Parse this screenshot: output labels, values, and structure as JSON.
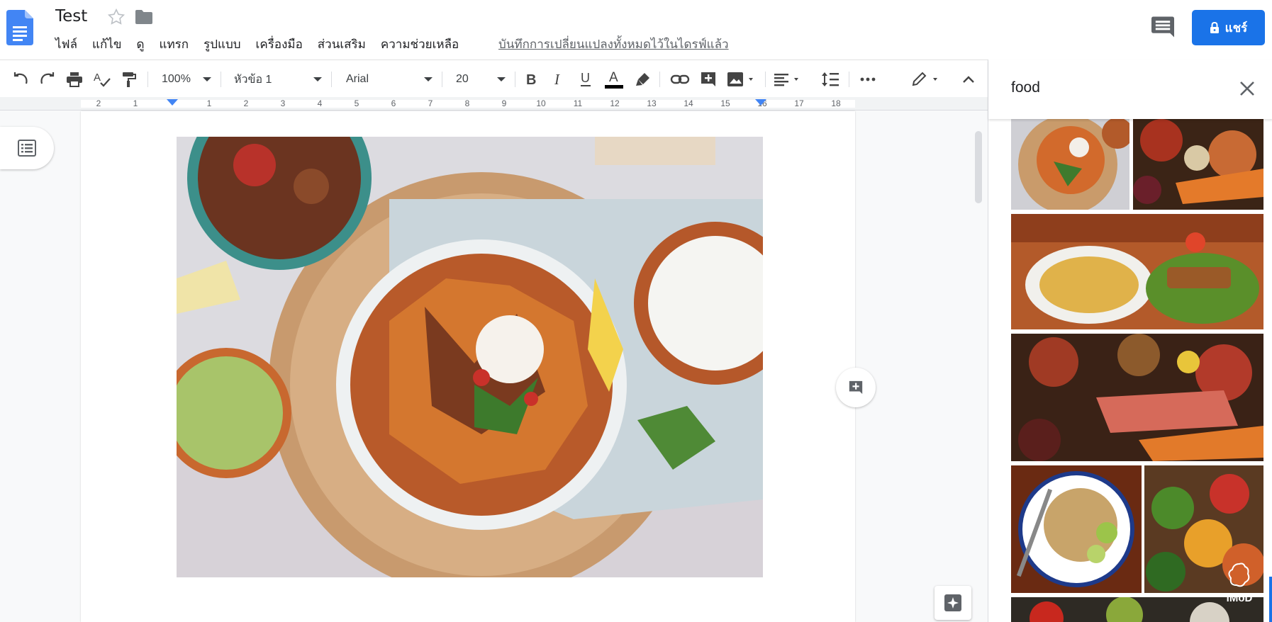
{
  "document": {
    "title": "Test"
  },
  "menu": [
    "ไฟล์",
    "แก้ไข",
    "ดู",
    "แทรก",
    "รูปแบบ",
    "เครื่องมือ",
    "ส่วนเสริม",
    "ความช่วยเหลือ"
  ],
  "save_status": "บันทึกการเปลี่ยนแปลงทั้งหมดไว้ในไดรฟ์แล้ว",
  "share": {
    "label": "แชร์"
  },
  "toolbar": {
    "zoom": "100%",
    "style": "หัวข้อ 1",
    "font": "Arial",
    "font_size": "20"
  },
  "ruler": {
    "numbers": [
      "2",
      "1",
      "1",
      "2",
      "3",
      "4",
      "5",
      "6",
      "7",
      "8",
      "9",
      "10",
      "11",
      "12",
      "13",
      "14",
      "15",
      "16",
      "17",
      "18"
    ]
  },
  "explore": {
    "search_query": "food"
  },
  "watermark": "iMoD",
  "colors": {
    "accent": "#1a73e8",
    "docs_blue": "#4285f4",
    "text_color_bar": "#000000"
  },
  "icons": [
    "docs-logo-icon",
    "star-icon",
    "folder-icon",
    "comment-icon",
    "lock-icon",
    "undo-icon",
    "redo-icon",
    "print-icon",
    "spellcheck-icon",
    "paint-format-icon",
    "bold-icon",
    "italic-icon",
    "underline-icon",
    "text-color-icon",
    "highlight-icon",
    "link-icon",
    "add-comment-icon",
    "insert-image-icon",
    "align-icon",
    "line-spacing-icon",
    "more-icon",
    "edit-mode-icon",
    "collapse-icon",
    "outline-icon",
    "close-icon",
    "explore-icon"
  ]
}
